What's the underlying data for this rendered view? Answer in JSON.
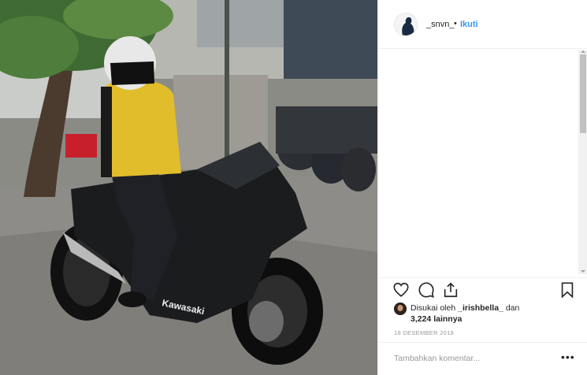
{
  "post": {
    "image_description_icon": "photo",
    "brand_decal": "Kawasaki"
  },
  "header": {
    "username": "_snvn_",
    "separator": "•",
    "follow_label": "Ikuti"
  },
  "actions": {
    "like_icon": "heart-icon",
    "comment_icon": "comment-icon",
    "share_icon": "share-icon",
    "save_icon": "bookmark-icon"
  },
  "likes": {
    "prefix": "Disukai oleh",
    "liker": "_irishbella_",
    "joiner": "dan",
    "count": "3,224 lainnya"
  },
  "date": "18 DESEMBER 2018",
  "comment": {
    "placeholder": "Tambahkan komentar...",
    "more_label": "•••"
  },
  "colors": {
    "follow": "#3897f0",
    "text": "#262626",
    "muted": "#999999",
    "border": "#efefef"
  }
}
